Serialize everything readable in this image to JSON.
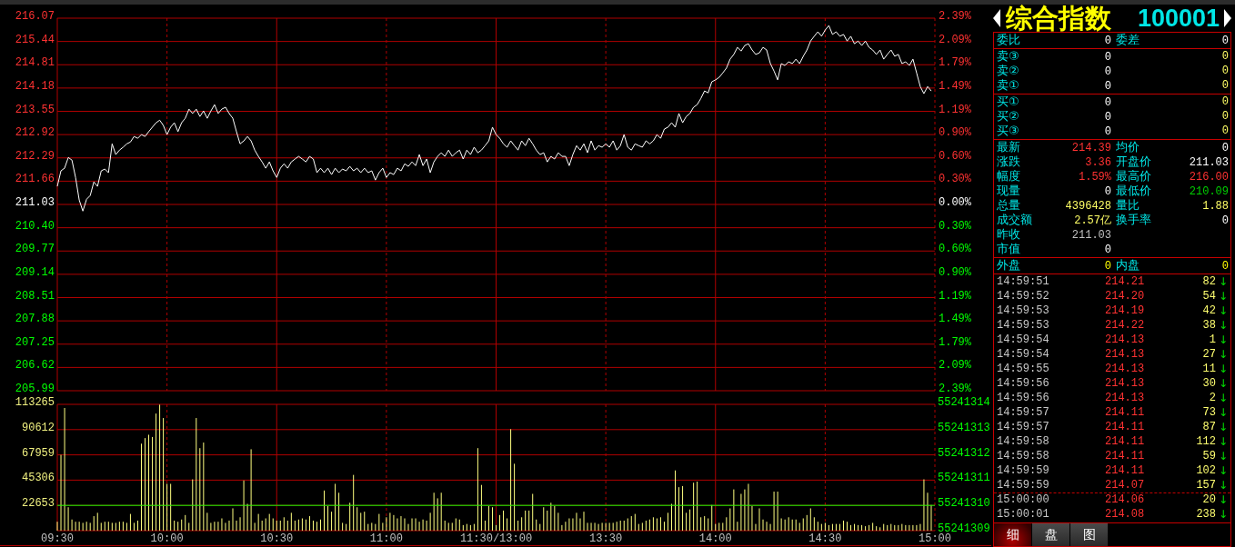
{
  "price_chart": {
    "chart_data": {
      "type": "line",
      "grid": true,
      "ylim": [
        205.99,
        216.07
      ],
      "yticks": [
        {
          "value": 216.07,
          "label": "216.07"
        },
        {
          "value": 215.44,
          "label": "215.44"
        },
        {
          "value": 214.81,
          "label": "214.81"
        },
        {
          "value": 214.18,
          "label": "214.18"
        },
        {
          "value": 213.55,
          "label": "213.55"
        },
        {
          "value": 212.92,
          "label": "212.92"
        },
        {
          "value": 212.29,
          "label": "212.29"
        },
        {
          "value": 211.66,
          "label": "211.66"
        },
        {
          "value": 211.03,
          "label": "211.03"
        },
        {
          "value": 210.4,
          "label": "210.40"
        },
        {
          "value": 209.77,
          "label": "209.77"
        },
        {
          "value": 209.14,
          "label": "209.14"
        },
        {
          "value": 208.51,
          "label": "208.51"
        },
        {
          "value": 207.88,
          "label": "207.88"
        },
        {
          "value": 207.25,
          "label": "207.25"
        },
        {
          "value": 206.62,
          "label": "206.62"
        },
        {
          "value": 205.99,
          "label": "205.99"
        }
      ],
      "series": [
        {
          "color": "#ffffff",
          "values": [
            211.52,
            211.94,
            212.01,
            212.3,
            212.23,
            211.76,
            211.15,
            210.85,
            211.17,
            211.27,
            211.64,
            211.52,
            211.94,
            211.99,
            211.89,
            212.67,
            212.38,
            212.5,
            212.58,
            212.67,
            212.72,
            212.87,
            212.82,
            212.92,
            212.87,
            213.0,
            213.12,
            213.24,
            213.31,
            213.17,
            212.92,
            213.12,
            213.24,
            213.0,
            213.24,
            213.36,
            213.61,
            213.49,
            213.61,
            213.41,
            213.56,
            213.36,
            213.56,
            213.73,
            213.49,
            213.61,
            213.66,
            213.49,
            213.36,
            213.0,
            212.67,
            212.75,
            212.87,
            212.75,
            212.5,
            212.33,
            212.18,
            212.01,
            212.18,
            211.94,
            211.76,
            212.01,
            212.13,
            212.01,
            212.18,
            212.26,
            212.33,
            212.26,
            212.18,
            212.33,
            212.26,
            211.89,
            212.01,
            211.89,
            212.01,
            211.84,
            212.01,
            211.89,
            211.99,
            211.94,
            212.06,
            211.94,
            212.01,
            211.89,
            212.01,
            211.89,
            211.94,
            211.69,
            211.89,
            212.01,
            211.76,
            211.89,
            211.84,
            212.01,
            211.94,
            212.13,
            212.06,
            212.18,
            212.08,
            212.38,
            212.08,
            212.26,
            211.89,
            212.18,
            212.33,
            212.43,
            212.33,
            212.5,
            212.33,
            212.43,
            212.5,
            212.26,
            212.5,
            212.38,
            212.58,
            212.43,
            212.5,
            212.62,
            212.75,
            213.12,
            212.92,
            212.82,
            212.67,
            212.58,
            212.75,
            212.62,
            212.5,
            212.75,
            212.62,
            212.82,
            212.67,
            212.5,
            212.38,
            212.43,
            212.18,
            212.33,
            212.26,
            212.43,
            212.33,
            212.33,
            212.08,
            212.38,
            212.62,
            212.5,
            212.67,
            212.43,
            212.75,
            212.5,
            212.62,
            212.58,
            212.67,
            212.58,
            212.75,
            212.5,
            212.62,
            212.92,
            212.58,
            212.5,
            212.67,
            212.62,
            212.58,
            212.75,
            212.67,
            212.75,
            212.92,
            212.82,
            213.07,
            213.12,
            213.24,
            213.12,
            213.49,
            213.24,
            213.41,
            213.49,
            213.66,
            213.73,
            213.9,
            214.1,
            214.05,
            214.35,
            214.4,
            214.47,
            214.59,
            214.72,
            214.96,
            215.09,
            215.28,
            215.18,
            215.33,
            215.38,
            215.21,
            215.09,
            215.13,
            215.28,
            215.21,
            214.84,
            214.64,
            214.4,
            214.84,
            214.79,
            214.89,
            214.84,
            214.96,
            214.84,
            215.04,
            215.21,
            215.45,
            215.58,
            215.7,
            215.58,
            215.75,
            215.87,
            215.63,
            215.7,
            215.58,
            215.63,
            215.45,
            215.58,
            215.38,
            215.45,
            215.33,
            215.45,
            215.28,
            215.21,
            215.09,
            215.21,
            214.96,
            215.09,
            215.21,
            215.04,
            215.09,
            214.84,
            214.89,
            214.79,
            214.96,
            214.59,
            214.22,
            214.03,
            214.22,
            214.1
          ]
        }
      ]
    },
    "change_labels": [
      {
        "label": "2.39%",
        "color": "#ff3232"
      },
      {
        "label": "2.09%",
        "color": "#ff3232"
      },
      {
        "label": "1.79%",
        "color": "#ff3232"
      },
      {
        "label": "1.49%",
        "color": "#ff3232"
      },
      {
        "label": "1.19%",
        "color": "#ff3232"
      },
      {
        "label": "0.90%",
        "color": "#ff3232"
      },
      {
        "label": "0.60%",
        "color": "#ff3232"
      },
      {
        "label": "0.30%",
        "color": "#ff3232"
      },
      {
        "label": "0.00%",
        "color": "#ffffff"
      },
      {
        "label": "0.30%",
        "color": "#00ff00"
      },
      {
        "label": "0.60%",
        "color": "#00ff00"
      },
      {
        "label": "0.90%",
        "color": "#00ff00"
      },
      {
        "label": "1.19%",
        "color": "#00ff00"
      },
      {
        "label": "1.49%",
        "color": "#00ff00"
      },
      {
        "label": "1.79%",
        "color": "#00ff00"
      },
      {
        "label": "2.09%",
        "color": "#00ff00"
      },
      {
        "label": "2.39%",
        "color": "#00ff00"
      }
    ]
  },
  "volume_chart": {
    "chart_data": {
      "type": "bar",
      "grid": true,
      "ylim": [
        0,
        113265
      ],
      "yticks": [
        {
          "value": 113265,
          "label": "113265"
        },
        {
          "value": 90612,
          "label": "90612"
        },
        {
          "value": 67959,
          "label": "67959"
        },
        {
          "value": 45306,
          "label": "45306"
        },
        {
          "value": 22653,
          "label": "22653"
        }
      ],
      "series": [
        {
          "color": "#ffff80",
          "values": [
            8000,
            68000,
            110000,
            21000,
            10000,
            8000,
            8000,
            7000,
            8000,
            7000,
            13000,
            16000,
            7000,
            8000,
            8000,
            7000,
            7000,
            8000,
            8000,
            7000,
            15000,
            7000,
            9000,
            78000,
            83000,
            86000,
            84000,
            105000,
            113000,
            101000,
            42000,
            42000,
            9000,
            8000,
            10000,
            14000,
            7000,
            46000,
            101000,
            74000,
            79000,
            16000,
            7000,
            8000,
            8000,
            11000,
            7000,
            9000,
            20000,
            9000,
            12000,
            45000,
            24000,
            73000,
            7000,
            15000,
            9000,
            11000,
            15000,
            11000,
            9000,
            9000,
            12000,
            9000,
            16000,
            9000,
            10000,
            11000,
            10000,
            13000,
            9000,
            8000,
            10000,
            36000,
            22000,
            17000,
            42000,
            34000,
            7000,
            6000,
            25000,
            50000,
            21000,
            16000,
            17000,
            6000,
            7000,
            6000,
            15000,
            7000,
            12000,
            16000,
            14000,
            11000,
            13000,
            11000,
            6000,
            11000,
            11000,
            8000,
            10000,
            9000,
            16000,
            34000,
            29000,
            34000,
            9000,
            7000,
            7000,
            11000,
            10000,
            5000,
            6000,
            5000,
            6000,
            74000,
            41000,
            9000,
            22000,
            21000,
            5000,
            14000,
            18000,
            11000,
            91000,
            60000,
            9000,
            12000,
            18000,
            18000,
            33000,
            10000,
            6000,
            21000,
            18000,
            25000,
            22000,
            16000,
            5000,
            8000,
            11000,
            11000,
            16000,
            11000,
            17000,
            7000,
            7000,
            7000,
            6000,
            7000,
            7000,
            7000,
            7000,
            8000,
            9000,
            9000,
            11000,
            13000,
            15000,
            6000,
            7000,
            9000,
            10000,
            12000,
            11000,
            12000,
            8000,
            16000,
            24000,
            54000,
            39000,
            40000,
            16000,
            19000,
            43000,
            44000,
            12000,
            13000,
            11000,
            23000,
            6000,
            7000,
            7000,
            12000,
            20000,
            37000,
            8000,
            33000,
            37000,
            42000,
            22000,
            6000,
            20000,
            10000,
            8000,
            6000,
            35000,
            35000,
            11000,
            10000,
            12000,
            10000,
            10000,
            7000,
            11000,
            14000,
            20000,
            12000,
            8000,
            6000,
            7000,
            5000,
            6000,
            6000,
            6000,
            9000,
            8000,
            5000,
            6000,
            5000,
            5000,
            4000,
            5000,
            7000,
            4000,
            3000,
            6000,
            5000,
            6000,
            5000,
            5000,
            6000,
            5000,
            5000,
            5000,
            5000,
            6000,
            46000,
            34000,
            23000
          ]
        }
      ],
      "ref_lines": [
        {
          "axis": "y",
          "value": 22653,
          "color": "#00ff00"
        }
      ]
    },
    "right_labels": [
      "55241314",
      "55241313",
      "55241312",
      "55241311",
      "55241310",
      "55241309"
    ],
    "time_labels": [
      "09:30",
      "10:00",
      "10:30",
      "11:00",
      "11:30/13:00",
      "13:30",
      "14:00",
      "14:30",
      "15:00"
    ]
  },
  "quote_panel": {
    "name": "综合指数",
    "code": "100001",
    "ratio": [
      {
        "label": "委比",
        "value": "0",
        "color": "#ffffff"
      },
      {
        "label": "委差",
        "value": "0",
        "color": "#ffffff"
      }
    ],
    "asks": [
      {
        "label": "卖③",
        "price": "0",
        "volume": "0"
      },
      {
        "label": "卖②",
        "price": "0",
        "volume": "0"
      },
      {
        "label": "卖①",
        "price": "0",
        "volume": "0"
      }
    ],
    "bids": [
      {
        "label": "买①",
        "price": "0",
        "volume": "0"
      },
      {
        "label": "买②",
        "price": "0",
        "volume": "0"
      },
      {
        "label": "买③",
        "price": "0",
        "volume": "0"
      }
    ],
    "stats": [
      [
        {
          "label": "最新",
          "value": "214.39",
          "color": "#ff3232"
        },
        {
          "label": "均价",
          "value": "0",
          "color": "#ffffff"
        }
      ],
      [
        {
          "label": "涨跌",
          "value": "3.36",
          "color": "#ff3232"
        },
        {
          "label": "开盘价",
          "value": "211.03",
          "color": "#ffffff"
        }
      ],
      [
        {
          "label": "幅度",
          "value": "1.59%",
          "color": "#ff3232"
        },
        {
          "label": "最高价",
          "value": "216.00",
          "color": "#ff3232"
        }
      ],
      [
        {
          "label": "现量",
          "value": "0",
          "color": "#ffffff"
        },
        {
          "label": "最低价",
          "value": "210.09",
          "color": "#00d000"
        }
      ],
      [
        {
          "label": "总量",
          "value": "4396428",
          "color": "#ffff66"
        },
        {
          "label": "量比",
          "value": "1.88",
          "color": "#ffff66"
        }
      ],
      [
        {
          "label": "成交额",
          "value": "2.57亿",
          "color": "#ffff66"
        },
        {
          "label": "换手率",
          "value": "0",
          "color": "#ffffff"
        }
      ],
      [
        {
          "label": "昨收",
          "value": "211.03",
          "color": "#c0c0c0"
        }
      ],
      [
        {
          "label": "市值",
          "value": "0",
          "color": "#ffffff"
        }
      ]
    ],
    "flow": [
      {
        "label": "外盘",
        "value": "0",
        "color": "#ffff00"
      },
      {
        "label": "内盘",
        "value": "0",
        "color": "#ffff00"
      }
    ],
    "trades": [
      {
        "time": "14:59:51",
        "price": "214.21",
        "volume": "82",
        "arrow": "↓",
        "break_before": false
      },
      {
        "time": "14:59:52",
        "price": "214.20",
        "volume": "54",
        "arrow": "↓",
        "break_before": false
      },
      {
        "time": "14:59:53",
        "price": "214.19",
        "volume": "42",
        "arrow": "↓",
        "break_before": false
      },
      {
        "time": "14:59:53",
        "price": "214.22",
        "volume": "38",
        "arrow": "↓",
        "break_before": false
      },
      {
        "time": "14:59:54",
        "price": "214.13",
        "volume": "1",
        "arrow": "↓",
        "break_before": false
      },
      {
        "time": "14:59:54",
        "price": "214.13",
        "volume": "27",
        "arrow": "↓",
        "break_before": false
      },
      {
        "time": "14:59:55",
        "price": "214.13",
        "volume": "11",
        "arrow": "↓",
        "break_before": false
      },
      {
        "time": "14:59:56",
        "price": "214.13",
        "volume": "30",
        "arrow": "↓",
        "break_before": false
      },
      {
        "time": "14:59:56",
        "price": "214.13",
        "volume": "2",
        "arrow": "↓",
        "break_before": false
      },
      {
        "time": "14:59:57",
        "price": "214.11",
        "volume": "73",
        "arrow": "↓",
        "break_before": false
      },
      {
        "time": "14:59:57",
        "price": "214.11",
        "volume": "87",
        "arrow": "↓",
        "break_before": false
      },
      {
        "time": "14:59:58",
        "price": "214.11",
        "volume": "112",
        "arrow": "↓",
        "break_before": false
      },
      {
        "time": "14:59:58",
        "price": "214.11",
        "volume": "59",
        "arrow": "↓",
        "break_before": false
      },
      {
        "time": "14:59:59",
        "price": "214.11",
        "volume": "102",
        "arrow": "↓",
        "break_before": false
      },
      {
        "time": "14:59:59",
        "price": "214.07",
        "volume": "157",
        "arrow": "↓",
        "break_before": false
      },
      {
        "time": "15:00:00",
        "price": "214.06",
        "volume": "20",
        "arrow": "↓",
        "break_before": true
      },
      {
        "time": "15:00:01",
        "price": "214.08",
        "volume": "238",
        "arrow": "↓",
        "break_before": false
      }
    ],
    "tabs": [
      {
        "label": "细",
        "selected": true
      },
      {
        "label": "盘",
        "selected": false
      },
      {
        "label": "图",
        "selected": false
      }
    ]
  }
}
